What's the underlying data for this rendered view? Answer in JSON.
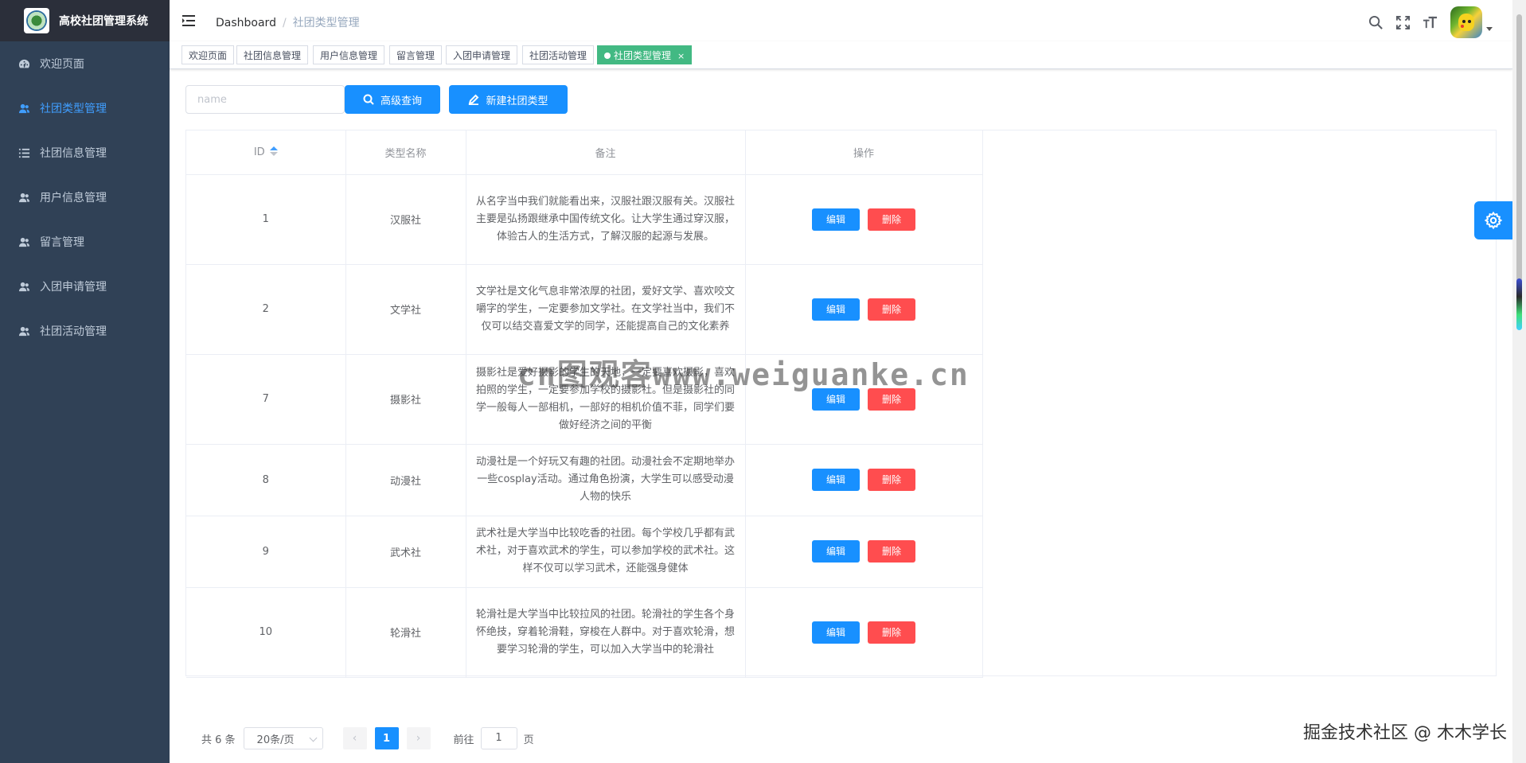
{
  "app": {
    "title": "高校社团管理系统"
  },
  "sidebar": {
    "items": [
      {
        "label": "欢迎页面",
        "icon": "dashboard-icon",
        "active": false
      },
      {
        "label": "社团类型管理",
        "icon": "user-icon",
        "active": true
      },
      {
        "label": "社团信息管理",
        "icon": "list-icon",
        "active": false
      },
      {
        "label": "用户信息管理",
        "icon": "user-icon",
        "active": false
      },
      {
        "label": "留言管理",
        "icon": "user-icon",
        "active": false
      },
      {
        "label": "入团申请管理",
        "icon": "user-icon",
        "active": false
      },
      {
        "label": "社团活动管理",
        "icon": "user-icon",
        "active": false
      }
    ]
  },
  "navbar": {
    "breadcrumb": {
      "home": "Dashboard",
      "separator": "/",
      "current": "社团类型管理"
    },
    "icons": [
      "search-icon",
      "fullscreen-icon",
      "font-size-icon"
    ]
  },
  "tags": [
    {
      "label": "欢迎页面",
      "active": false
    },
    {
      "label": "社团信息管理",
      "active": false
    },
    {
      "label": "用户信息管理",
      "active": false
    },
    {
      "label": "留言管理",
      "active": false
    },
    {
      "label": "入团申请管理",
      "active": false
    },
    {
      "label": "社团活动管理",
      "active": false
    },
    {
      "label": "社团类型管理",
      "active": true,
      "close": "×"
    }
  ],
  "search": {
    "placeholder": "name",
    "query_button": "高级查询",
    "add_button": "新建社团类型"
  },
  "table": {
    "headers": {
      "id": "ID",
      "name": "类型名称",
      "remark": "备注",
      "actions": "操作"
    },
    "edit_label": "编辑",
    "delete_label": "删除",
    "rows": [
      {
        "id": "1",
        "name": "汉服社",
        "remark": "从名字当中我们就能看出来，汉服社跟汉服有关。汉服社主要是弘扬跟继承中国传统文化。让大学生通过穿汉服，体验古人的生活方式，了解汉服的起源与发展。"
      },
      {
        "id": "2",
        "name": "文学社",
        "remark": "文学社是文化气息非常浓厚的社团，爱好文学、喜欢咬文嚼字的学生，一定要参加文学社。在文学社当中，我们不仅可以结交喜爱文学的同学，还能提高自己的文化素养"
      },
      {
        "id": "7",
        "name": "摄影社",
        "remark": "摄影社是爱好摄影的学生的天地，一定要喜欢摄影，喜欢拍照的学生，一定要参加学校的摄影社。但是摄影社的同学一般每人一部相机，一部好的相机价值不菲，同学们要做好经济之间的平衡"
      },
      {
        "id": "8",
        "name": "动漫社",
        "remark": "动漫社是一个好玩又有趣的社团。动漫社会不定期地举办一些cosplay活动。通过角色扮演，大学生可以感受动漫人物的快乐"
      },
      {
        "id": "9",
        "name": "武术社",
        "remark": "武术社是大学当中比较吃香的社团。每个学校几乎都有武术社，对于喜欢武术的学生，可以参加学校的武术社。这样不仅可以学习武术，还能强身健体"
      },
      {
        "id": "10",
        "name": "轮滑社",
        "remark": "轮滑社是大学当中比较拉风的社团。轮滑社的学生各个身怀绝技，穿着轮滑鞋，穿梭在人群中。对于喜欢轮滑，想要学习轮滑的学生，可以加入大学当中的轮滑社"
      }
    ]
  },
  "pagination": {
    "total": "共 6 条",
    "page_size": "20条/页",
    "prev": "‹",
    "next": "›",
    "current_page": "1",
    "goto_label": "前往",
    "goto_value": "1",
    "page_suffix": "页"
  },
  "watermarks": {
    "center": "cn图观客www.weiguanke.cn",
    "bottom": "掘金技术社区 @ 木木学长"
  },
  "colors": {
    "sidebar_bg": "#304156",
    "accent": "#1890ff",
    "active_menu": "#409eff",
    "active_tag": "#42b983",
    "danger": "#ff4d4f"
  }
}
